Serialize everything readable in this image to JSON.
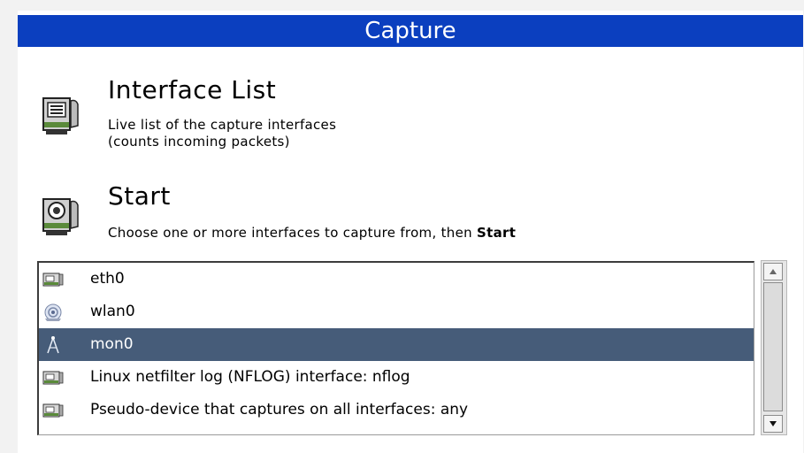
{
  "header": {
    "title": "Capture"
  },
  "interface_list": {
    "title": "Interface List",
    "desc_line1": "Live list of the capture interfaces",
    "desc_line2": "(counts incoming packets)"
  },
  "start": {
    "title": "Start",
    "desc_prefix": "Choose one or more interfaces to capture from, then ",
    "desc_bold": "Start"
  },
  "interfaces": [
    {
      "label": "eth0",
      "icon": "network-card-icon",
      "selected": false
    },
    {
      "label": "wlan0",
      "icon": "wireless-icon",
      "selected": false
    },
    {
      "label": "mon0",
      "icon": "antenna-icon",
      "selected": true
    },
    {
      "label": "Linux netfilter log (NFLOG) interface: nflog",
      "icon": "network-card-icon",
      "selected": false
    },
    {
      "label": "Pseudo-device that captures on all interfaces: any",
      "icon": "network-card-icon",
      "selected": false
    }
  ],
  "colors": {
    "header": "#0b3fbf",
    "selected_row": "#465c79"
  }
}
